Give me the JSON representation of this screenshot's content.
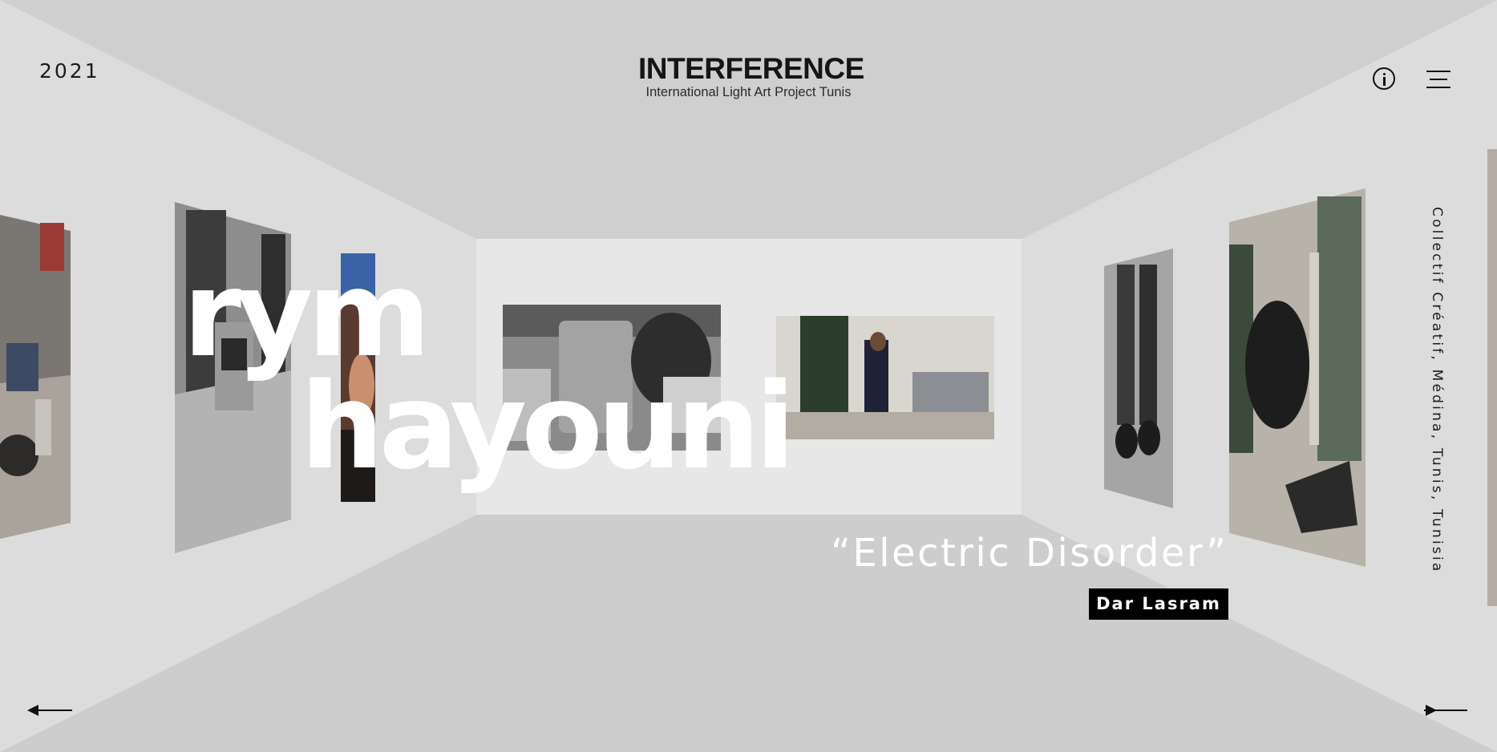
{
  "header": {
    "year": "2021",
    "logo_title": "INTERFERENCE",
    "logo_subtitle": "International Light Art Project Tunis"
  },
  "icons": {
    "info": "info-icon",
    "menu": "hamburger-menu-icon",
    "prev": "arrow-left-icon",
    "next": "arrow-right-icon"
  },
  "artist": {
    "first_name": "rym",
    "last_name": "hayouni"
  },
  "artwork": {
    "title": "“Electric Disorder”",
    "venue": "Dar Lasram"
  },
  "location_text": "Collectif Créatif, Médina, Tunis, Tunisia",
  "colors": {
    "background": "#d3d3d3",
    "back_wall": "#e6e6e6",
    "text_dark": "#111111",
    "badge": "#000000",
    "overlay_text": "#ffffff"
  }
}
